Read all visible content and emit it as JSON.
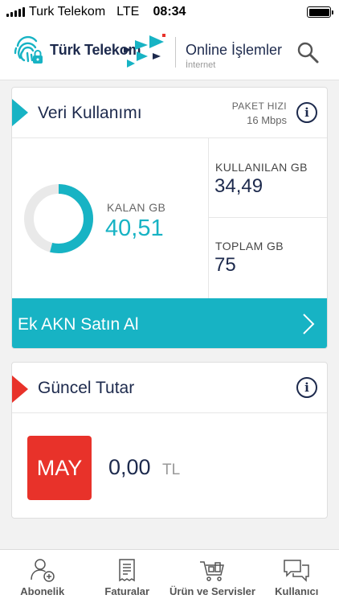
{
  "status_bar": {
    "carrier": "Turk Telekom",
    "network": "LTE",
    "time": "08:34"
  },
  "header": {
    "brand": "Türk Telekom",
    "section_title": "Online İşlemler",
    "section_subtitle": "İnternet",
    "search_icon": "search-icon"
  },
  "usage_card": {
    "title": "Veri Kullanımı",
    "speed_label": "PAKET HIZI",
    "speed_value": "16 Mbps",
    "remaining_label": "KALAN GB",
    "remaining_value": "40,51",
    "used_label": "KULLANILAN GB",
    "used_value": "34,49",
    "total_label": "TOPLAM GB",
    "total_value": "75",
    "remaining_fraction": 0.5401,
    "buy_button": "Ek AKN Satın Al"
  },
  "bill_card": {
    "title": "Güncel Tutar",
    "month": "MAY",
    "amount": "0,00",
    "currency": "TL"
  },
  "tabs": [
    {
      "label": "Abonelik",
      "icon": "user-add-icon"
    },
    {
      "label": "Faturalar",
      "icon": "receipt-icon"
    },
    {
      "label": "Ürün ve Servisler",
      "icon": "cart-icon"
    },
    {
      "label": "Kullanıcı",
      "icon": "chat-icon"
    }
  ],
  "colors": {
    "accent": "#17b3c4",
    "alert": "#e8322a",
    "text": "#1d2a4d"
  }
}
